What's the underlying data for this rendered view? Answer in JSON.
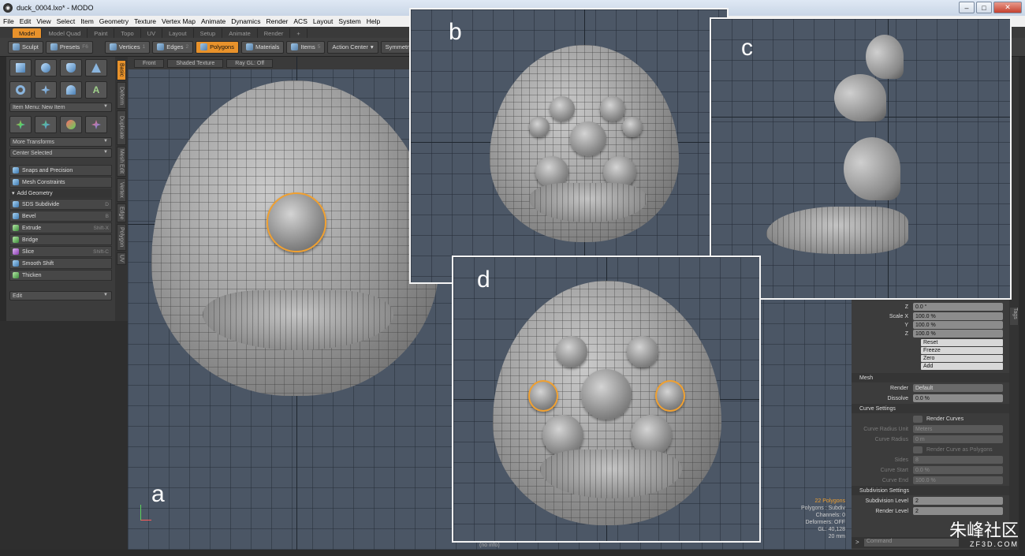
{
  "window": {
    "title": "duck_0004.lxo* - MODO"
  },
  "menu": [
    "File",
    "Edit",
    "View",
    "Select",
    "Item",
    "Geometry",
    "Texture",
    "Vertex Map",
    "Animate",
    "Dynamics",
    "Render",
    "ACS",
    "Layout",
    "System",
    "Help"
  ],
  "layout_tabs": [
    {
      "label": "Model",
      "active": true
    },
    {
      "label": "Model Quad"
    },
    {
      "label": "Paint"
    },
    {
      "label": "Topo"
    },
    {
      "label": "UV"
    },
    {
      "label": "Layout"
    },
    {
      "label": "Setup"
    },
    {
      "label": "Animate"
    },
    {
      "label": "Render"
    },
    {
      "label": "+"
    }
  ],
  "toolbar": {
    "sculpt": "Sculpt",
    "presets": "Presets",
    "presets_key": "F6",
    "vertices": "Vertices",
    "vertices_key": "1",
    "edges": "Edges",
    "edges_key": "2",
    "polygons": "Polygons",
    "materials": "Materials",
    "items": "Items",
    "items_key": "5",
    "action_center": "Action Center",
    "symmetry": "Symmetry: Of"
  },
  "left_panel": {
    "item_menu": "Item Menu: New Item",
    "more_transforms": "More Transforms",
    "center_selected": "Center Selected",
    "snaps": "Snaps and Precision",
    "mesh_constraints": "Mesh Constraints",
    "add_geometry": "Add Geometry",
    "tools": [
      {
        "label": "SDS Subdivide",
        "key": "D"
      },
      {
        "label": "Bevel",
        "key": "B"
      },
      {
        "label": "Extrude",
        "key": "Shift-X"
      },
      {
        "label": "Bridge",
        "key": ""
      },
      {
        "label": "Slice",
        "key": "Shift-C"
      },
      {
        "label": "Smooth Shift",
        "key": ""
      },
      {
        "label": "Thicken",
        "key": ""
      }
    ],
    "edit": "Edit"
  },
  "vertical_tabs": [
    "Basic",
    "Deform",
    "Duplicate",
    "Mesh Edit",
    "Vertex",
    "Edge",
    "Polygon",
    "UV"
  ],
  "viewport": {
    "view": "Front",
    "shading": "Shaded Texture",
    "raygl": "Ray GL: Off",
    "stats": {
      "polygons": "22 Polygons",
      "polytype": "Polygons : Subdiv",
      "channels": "Channels: 0",
      "deformers": "Deformers: OFF",
      "gl": "GL: 40,128",
      "unit": "20 mm"
    },
    "bottom_label": "(no info)"
  },
  "panel_letters": {
    "a": "a",
    "b": "b",
    "c": "c",
    "d": "d"
  },
  "right_panel": {
    "z_rot": {
      "label": "Z",
      "value": "0.0 °"
    },
    "scale_x": {
      "label": "Scale X",
      "value": "100.0 %"
    },
    "scale_y": {
      "label": "Y",
      "value": "100.0 %"
    },
    "scale_z": {
      "label": "Z",
      "value": "100.0 %"
    },
    "actions": [
      "Reset",
      "Freeze",
      "Zero",
      "Add"
    ],
    "mesh_header": "Mesh",
    "render": {
      "label": "Render",
      "value": "Default"
    },
    "dissolve": {
      "label": "Dissolve",
      "value": "0.0 %"
    },
    "curve_header": "Curve Settings",
    "render_curves": "Render Curves",
    "curve_radius_unit": {
      "label": "Curve Radius Unit",
      "value": "Meters"
    },
    "curve_radius": {
      "label": "Curve Radius",
      "value": "0 m"
    },
    "render_curve_polys": "Render Curve as Polygons",
    "sides": {
      "label": "Sides",
      "value": "8"
    },
    "curve_start": {
      "label": "Curve Start",
      "value": "0.0 %"
    },
    "curve_end": {
      "label": "Curve End",
      "value": "100.0 %"
    },
    "subdiv_header": "Subdivision Settings",
    "subdiv_level": {
      "label": "Subdivision Level",
      "value": "2"
    },
    "render_level": {
      "label": "Render Level",
      "value": "2"
    },
    "command": "Command",
    "side_tab": "Tags"
  },
  "watermark": {
    "cn": "朱峰社区",
    "en": "ZF3D.COM"
  },
  "colors": {
    "accent": "#e8922b",
    "selection": "#f0a030",
    "viewport_bg": "#4b5665"
  }
}
